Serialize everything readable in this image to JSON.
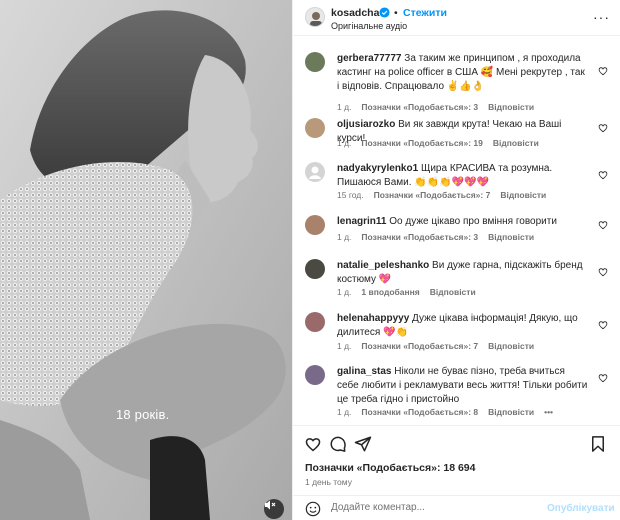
{
  "media": {
    "overlay_text": "18 років.",
    "mute_icon": "speaker-muted-icon"
  },
  "header": {
    "username": "kosadcha",
    "dot": "•",
    "follow_label": "Стежити",
    "audio_label": "Оригінальне аудіо",
    "more_label": "···"
  },
  "comments": [
    {
      "user": "gerbera77777",
      "text": "За таким же принципом , я проходила кастинг на police officer в США 🥰 Мені рекрутер , так і відповів. Спрацювало ✌️👍👌",
      "time": "1 д.",
      "likes": "Позначки «Подобається»: 3",
      "reply": "Відповісти",
      "avatar_color": "#6b7a5a"
    },
    {
      "user": "oljusiarozko",
      "text": "Ви як завжди крута! Чекаю на Ваші курси!",
      "time": "1 д.",
      "likes": "Позначки «Подобається»: 19",
      "reply": "Відповісти",
      "avatar_color": "#b89a7a"
    },
    {
      "user": "nadyakyrylenko1",
      "text": "Щира КРАСИВА та розумна. Пишаюся Вами. 👏👏👏💖💖💖",
      "time": "15 год.",
      "likes": "Позначки «Подобається»: 7",
      "reply": "Відповісти",
      "avatar_color": "#c7c7c7"
    },
    {
      "user": "lenagrin11",
      "text": "Оо дуже цікаво про вміння говорити",
      "time": "1 д.",
      "likes": "Позначки «Подобається»: 3",
      "reply": "Відповісти",
      "avatar_color": "#a8826a"
    },
    {
      "user": "natalie_peleshanko",
      "text": "Ви дуже гарна, підскажіть бренд костюму 💖",
      "time": "1 д.",
      "likes": "1 вподобання",
      "reply": "Відповісти",
      "avatar_color": "#4a4a42"
    },
    {
      "user": "helenahappyyy",
      "text": "Дуже цікава інформація! Дякую, що дилитеся 💖👏",
      "time": "1 д.",
      "likes": "Позначки «Подобається»: 7",
      "reply": "Відповісти",
      "avatar_color": "#9a6a6a"
    },
    {
      "user": "galina_stas",
      "text": "Ніколи не буває пізно, треба вчиться себе любити і рекламувати весь життя! Тільки робити це треба гідно і пристойно",
      "time": "1 д.",
      "likes": "Позначки «Подобається»: 8",
      "reply": "Відповісти",
      "more": "•••",
      "avatar_color": "#7a6a8a"
    }
  ],
  "actions": {
    "likes_text": "Позначки «Подобається»: 18 694",
    "time_text": "1 день тому",
    "comment_placeholder": "Додайте коментар...",
    "publish_label": "Опублікувати"
  },
  "colors": {
    "accent": "#0095f6",
    "muted": "#737373",
    "text": "#262626"
  }
}
